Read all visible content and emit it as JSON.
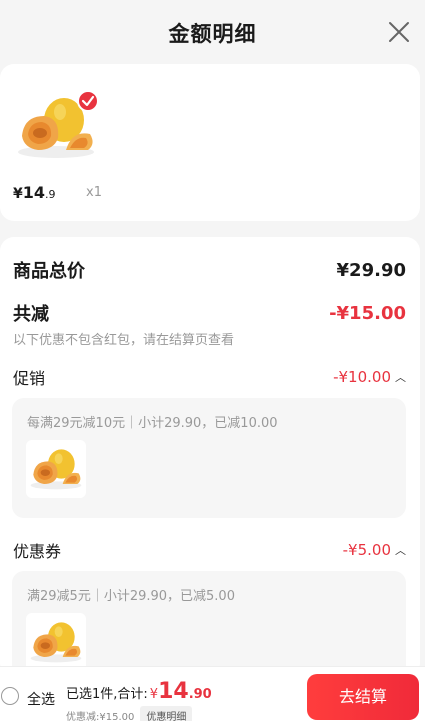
{
  "header": {
    "title": "金额明细",
    "close_icon": "close-icon"
  },
  "product": {
    "price_symbol": "¥",
    "price_int": "14",
    "price_dec": ".9",
    "quantity": "x1",
    "image_icon": "melon-image",
    "check_icon": "check-badge-icon"
  },
  "summary": {
    "total_label": "商品总价",
    "total_value": "¥29.90",
    "reduce_label": "共减",
    "reduce_value": "-¥15.00",
    "note": "以下优惠不包含红包，请在结算页查看"
  },
  "promotion": {
    "label": "促销",
    "value": "-¥10.00",
    "detail": "每满29元减10元｜小计29.90，已减10.00"
  },
  "coupon": {
    "label": "优惠券",
    "value": "-¥5.00",
    "detail": "满29减5元｜小计29.90，已减5.00"
  },
  "footer": {
    "select_all": "全选",
    "selected_text": "已选1件,合计:",
    "total_symbol": "¥",
    "total_int": "14",
    "total_dec": ".90",
    "discount_text": "优惠减:¥15.00",
    "detail_button": "优惠明细",
    "checkout_button": "去结算"
  },
  "colors": {
    "accent": "#e8333f",
    "background": "#f5f5f5"
  }
}
